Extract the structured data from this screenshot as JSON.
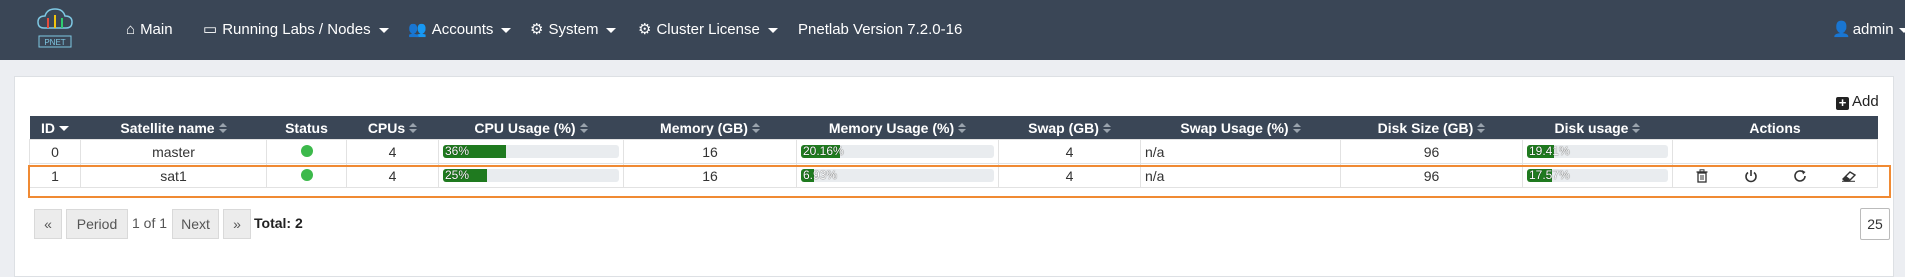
{
  "nav": {
    "items": [
      {
        "icon": "home-icon",
        "glyph": "⌂",
        "label": "Main",
        "dropdown": false
      },
      {
        "icon": "monitor-icon",
        "glyph": "▭",
        "label": "Running Labs / Nodes",
        "dropdown": true
      },
      {
        "icon": "users-icon",
        "glyph": "👥",
        "label": "Accounts",
        "dropdown": true
      },
      {
        "icon": "gear-icon",
        "glyph": "⚙",
        "label": "System",
        "dropdown": true
      },
      {
        "icon": "gear-icon",
        "glyph": "⚙",
        "label": "Cluster License",
        "dropdown": true
      }
    ],
    "version": "Pnetlab Version 7.2.0-16",
    "user": {
      "icon": "user-icon",
      "glyph": "👤",
      "label": "admin"
    },
    "logo_text": "PNET"
  },
  "toolbar": {
    "add_label": "Add"
  },
  "table": {
    "headers": [
      "ID",
      "Satellite name",
      "Status",
      "CPUs",
      "CPU Usage (%)",
      "Memory (GB)",
      "Memory Usage (%)",
      "Swap (GB)",
      "Swap Usage (%)",
      "Disk Size (GB)",
      "Disk usage",
      "Actions"
    ],
    "rows": [
      {
        "id": "0",
        "name": "master",
        "cpus": "4",
        "cpu_usage": {
          "label": "36%",
          "value": 36
        },
        "memory": "16",
        "memory_usage": {
          "label": "20.16%",
          "value": 20.16
        },
        "swap": "4",
        "swap_usage": "n/a",
        "disk": "96",
        "disk_usage": {
          "label": "19.41%",
          "value": 19.41
        },
        "actions": []
      },
      {
        "id": "1",
        "name": "sat1",
        "cpus": "4",
        "cpu_usage": {
          "label": "25%",
          "value": 25
        },
        "memory": "16",
        "memory_usage": {
          "label": "6.93%",
          "value": 6.93
        },
        "swap": "4",
        "swap_usage": "n/a",
        "disk": "96",
        "disk_usage": {
          "label": "17.57%",
          "value": 17.57
        },
        "actions": [
          "trash-icon",
          "power-icon",
          "refresh-icon",
          "eraser-icon"
        ]
      }
    ]
  },
  "pagination": {
    "prev_label": "Period",
    "page_info": "1 of 1",
    "next_label": "Next",
    "total_label": "Total: 2",
    "per_page": "25"
  },
  "colors": {
    "navbar": "#3a4656",
    "progress": "#1f7a1f",
    "status_online": "#3cb94b",
    "highlight": "#f08a33"
  }
}
